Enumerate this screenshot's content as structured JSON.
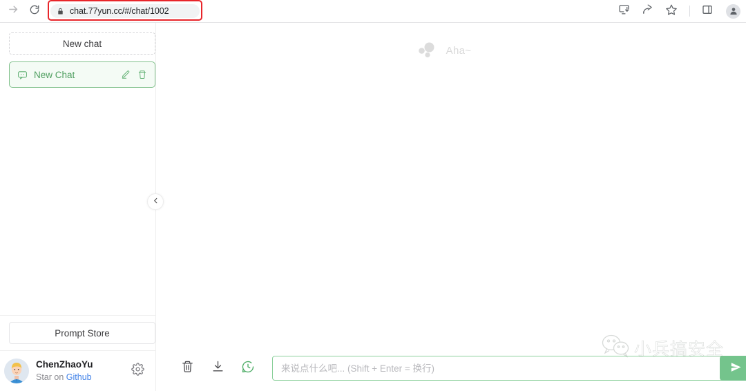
{
  "browser": {
    "forward_icon": "arrow-right-icon",
    "reload_icon": "reload-icon",
    "lock_icon": "lock-icon",
    "url": "chat.77yun.cc/#/chat/1002",
    "highlight_color": "#e8252a",
    "toolbar_icons": [
      "install-app-icon",
      "share-icon",
      "bookmark-star-icon",
      "side-panel-icon"
    ],
    "profile_icon": "profile-avatar-icon"
  },
  "sidebar": {
    "new_chat_label": "New chat",
    "chats": [
      {
        "icon": "chat-bubble-icon",
        "label": "New Chat",
        "active": true,
        "edit_icon": "pencil-icon",
        "delete_icon": "trash-icon"
      }
    ],
    "prompt_store_label": "Prompt Store",
    "footer": {
      "avatar": "user-avatar-icon",
      "name": "ChenZhaoYu",
      "sub_prefix": "Star on ",
      "sub_link": "Github",
      "settings_icon": "gear-icon"
    },
    "collapse_icon": "chevron-left-icon",
    "accent_green": "#4e9e5f",
    "active_bg": "#f4fbf5",
    "active_border": "#7fc08a"
  },
  "main": {
    "empty_logo": "aha-dots-logo",
    "empty_text": "Aha~"
  },
  "composer": {
    "clear_icon": "trash-icon",
    "export_icon": "download-icon",
    "history_icon": "chat-history-icon",
    "input_value": "",
    "input_placeholder": "来说点什么吧... (Shift + Enter = 换行)",
    "send_icon": "send-icon",
    "border_color": "#8bd09b",
    "send_bg": "#74c48c"
  },
  "watermark": {
    "icon": "wechat-icon",
    "text": "小兵搞安全"
  }
}
